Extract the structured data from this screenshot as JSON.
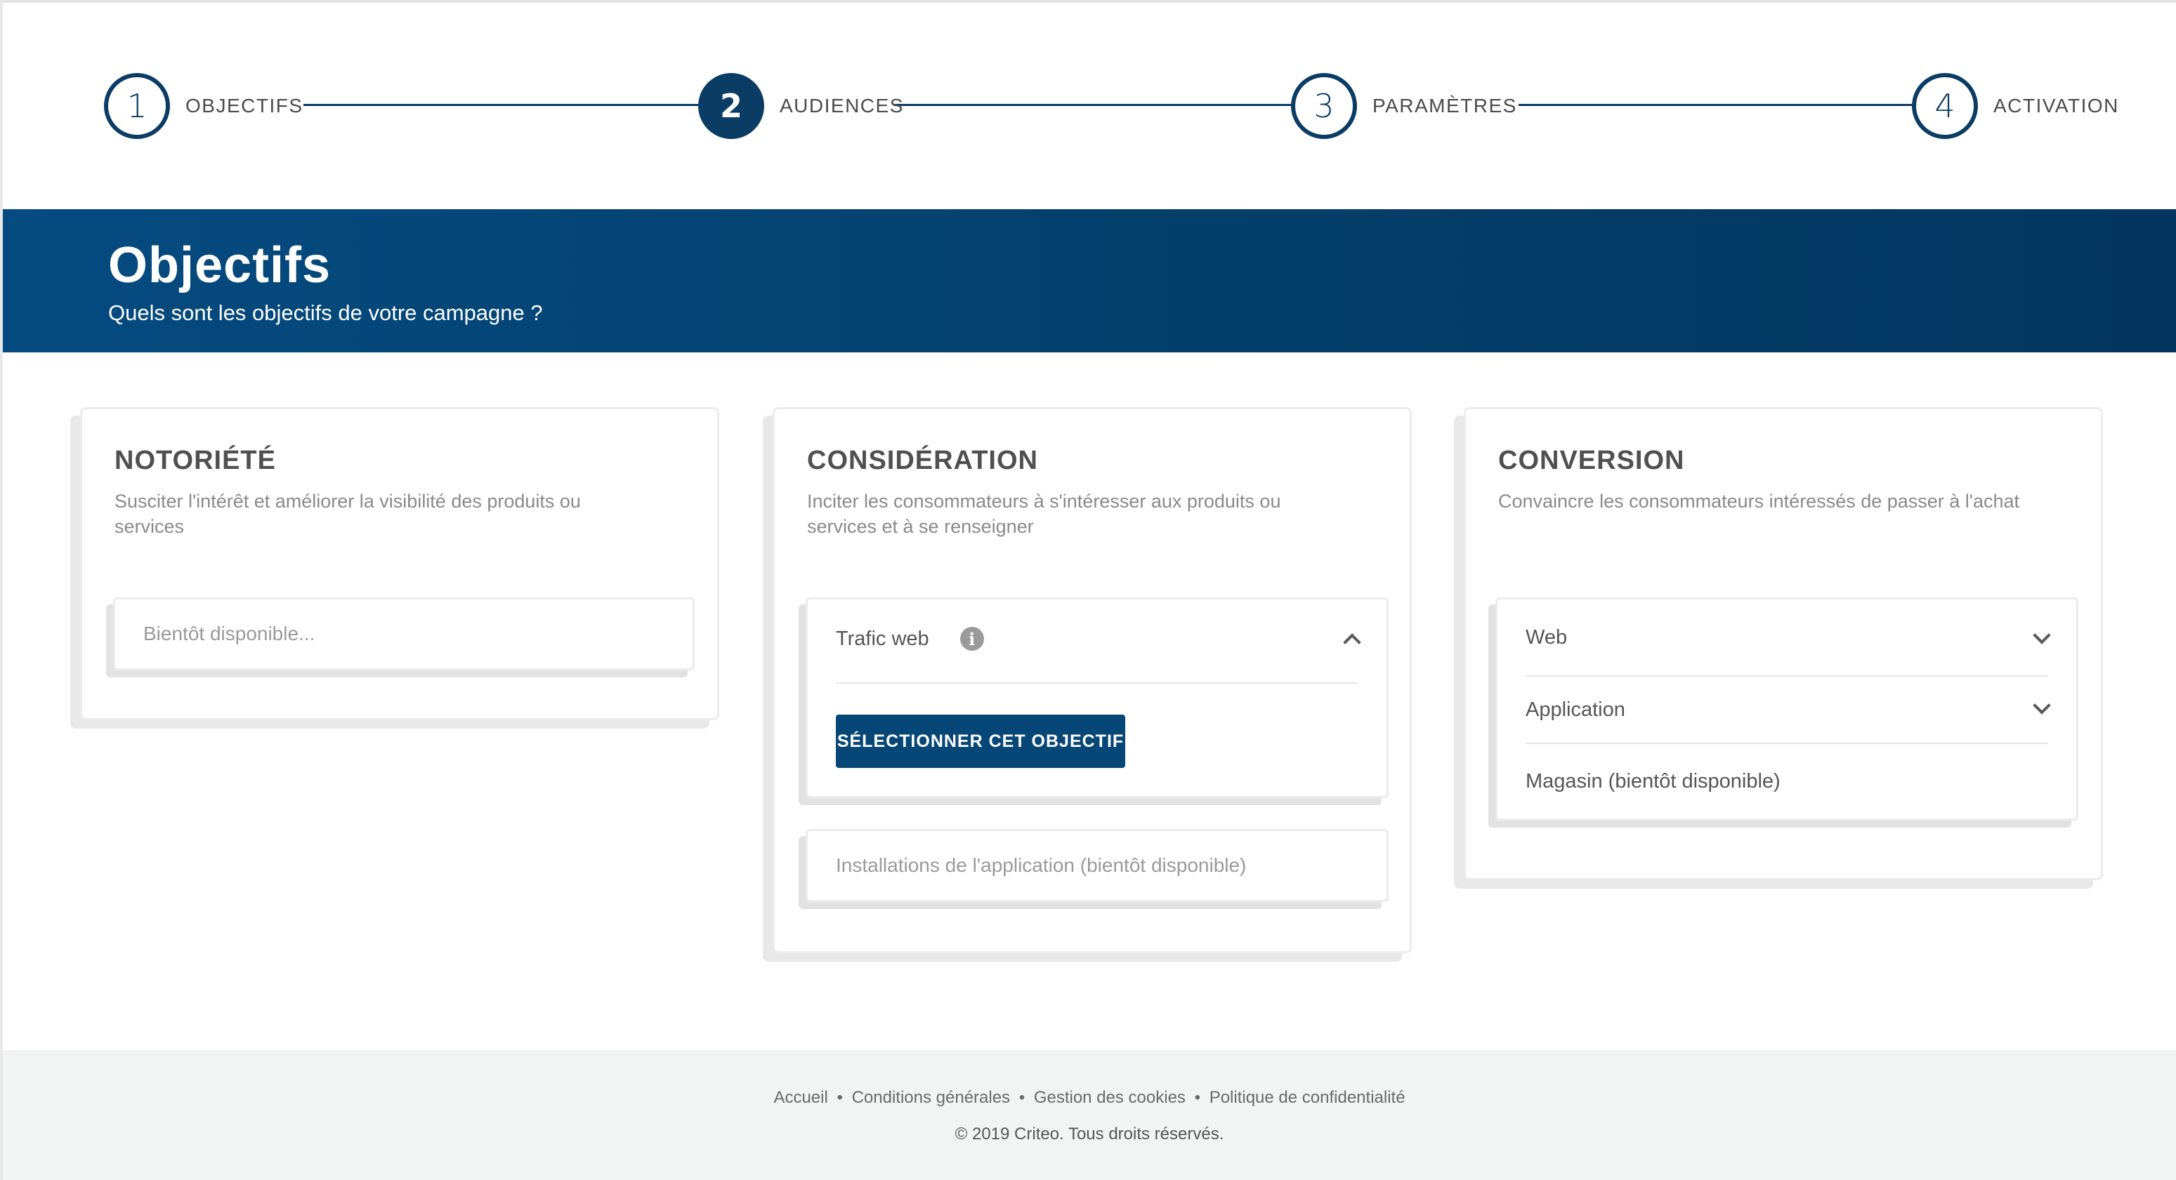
{
  "stepper": {
    "steps": [
      {
        "number": "1",
        "label": "OBJECTIFS"
      },
      {
        "number": "2",
        "label": "AUDIENCES"
      },
      {
        "number": "3",
        "label": "PARAMÈTRES"
      },
      {
        "number": "4",
        "label": "ACTIVATION"
      }
    ],
    "active_step": "2"
  },
  "hero": {
    "title": "Objectifs",
    "subtitle": "Quels sont les objectifs de votre campagne ?"
  },
  "cards": {
    "notoriete": {
      "title": "NOTORIÉTÉ",
      "description": "Susciter l'intérêt et améliorer la visibilité des produits ou services",
      "placeholder": "Bientôt disponible..."
    },
    "consideration": {
      "title": "CONSIDÉRATION",
      "description": "Inciter les consommateurs à s'intéresser aux produits ou services et à se renseigner",
      "traffic_label": "Trafic web",
      "info_glyph": "i",
      "select_button": "SÉLECTIONNER CET OBJECTIF",
      "installs_label": "Installations de l'application (bientôt disponible)"
    },
    "conversion": {
      "title": "CONVERSION",
      "description": "Convaincre les consommateurs intéressés de passer à l'achat",
      "items": [
        "Web",
        "Application",
        "Magasin (bientôt disponible)"
      ]
    }
  },
  "footer": {
    "links": [
      "Accueil",
      "Conditions générales",
      "Gestion des cookies",
      "Politique de confidentialité"
    ],
    "separator": "•",
    "copyright": "© 2019 Criteo. Tous droits réservés."
  },
  "colors": {
    "brand_navy": "#0a3d66",
    "hero_start": "#054b80",
    "hero_end": "#023660",
    "button": "#074777",
    "footer_bg": "#f2f3f3"
  },
  "icons": {
    "info": "info-icon",
    "expand": "chevron-down-icon",
    "collapse": "chevron-up-icon"
  }
}
